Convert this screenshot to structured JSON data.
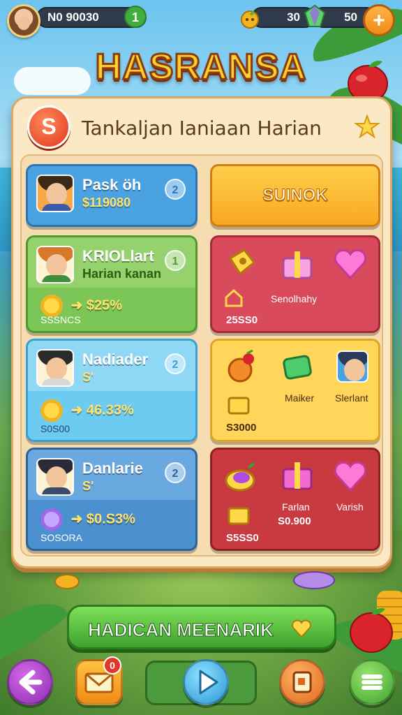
{
  "hud": {
    "player_value": "N0 90030",
    "level": "1",
    "fruit_count": "30",
    "gem_count": "50",
    "add_label": "+"
  },
  "title": "HASRANSA",
  "panel": {
    "badge": "S",
    "heading": "Tankaljan Ianiaan Harian"
  },
  "left_cards": [
    {
      "name": "Pask öh",
      "sub": "$119080",
      "num": "2"
    },
    {
      "name": "KRIOLlart",
      "sub": "Harian kanan",
      "num": "1",
      "reward": "$25%",
      "foot": "SSSNCS"
    },
    {
      "name": "Nadiader",
      "sub": "S'",
      "num": "2",
      "reward": "46.33%",
      "foot": "S0S00"
    },
    {
      "name": "Danlarie",
      "sub": "S'",
      "num": "2",
      "reward": "$0.S3%",
      "foot": "SOSORA"
    }
  ],
  "claim_button": "SUINOK",
  "right_cards": [
    {
      "label": "Senolhahy",
      "amount": "25SS0"
    },
    {
      "label_a": "Maiker",
      "label_b": "Slerlant",
      "amount": "S3000"
    },
    {
      "label_a": "Farlan",
      "amount_a": "S0.900",
      "label_b": "Varish",
      "amount": "S5SS0"
    }
  ],
  "cta_label": "HADICAN MEENARIK",
  "nav": {
    "mail_badge": "0"
  },
  "colors": {
    "title_gold": "#ffcf2e",
    "panel_cream": "#fbe9c6",
    "cta_green": "#3da32d",
    "claim_orange": "#f8a822"
  }
}
